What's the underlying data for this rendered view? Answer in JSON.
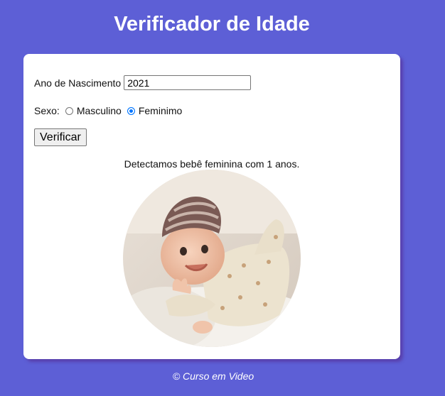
{
  "header": {
    "title": "Verificador de Idade"
  },
  "form": {
    "year_label": "Ano de Nascimento",
    "year_value": "2021",
    "sex_label": "Sexo:",
    "options": [
      {
        "label": "Masculino",
        "checked": false
      },
      {
        "label": "Feminimo",
        "checked": true
      }
    ],
    "verify_label": "Verificar"
  },
  "result": {
    "text": "Detectamos bebê feminina com 1 anos.",
    "image": "baby-girl-photo"
  },
  "footer": {
    "text": "© Curso em Video"
  },
  "colors": {
    "background": "#5d5fd6",
    "card": "#ffffff",
    "radio_accent": "#0075ff"
  }
}
